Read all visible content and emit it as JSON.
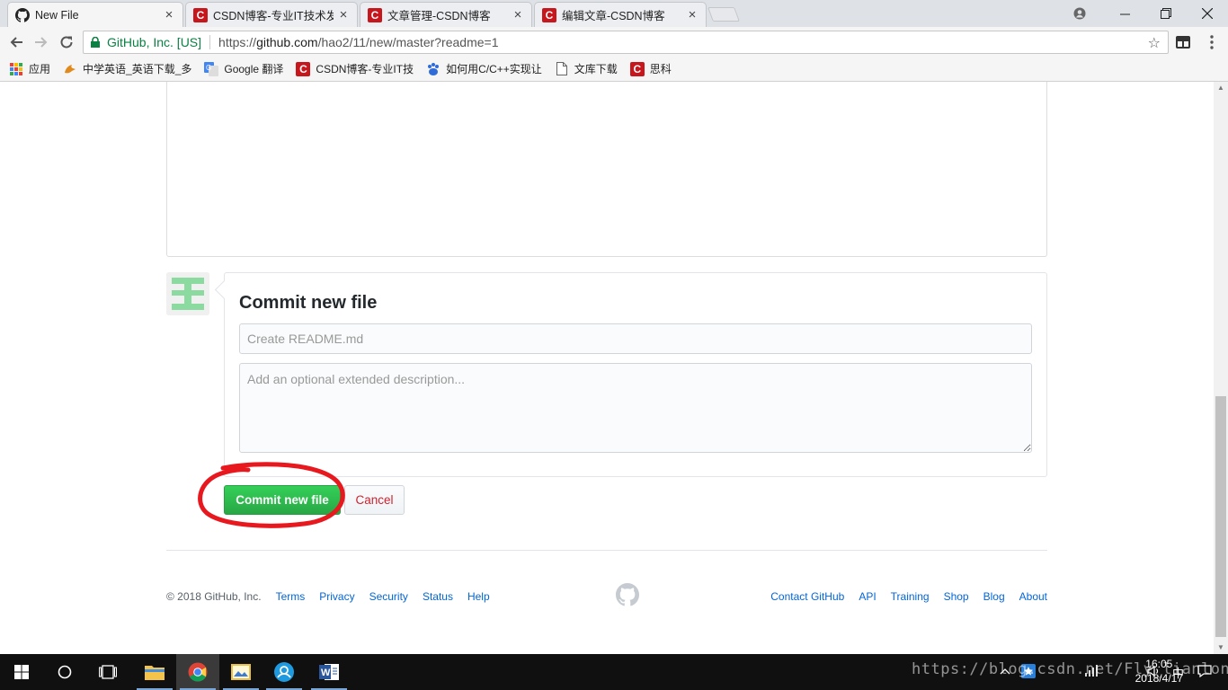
{
  "browser": {
    "tabs": [
      {
        "title": "New File",
        "favicon": "github-icon",
        "active": true
      },
      {
        "title": "CSDN博客-专业IT技术发",
        "favicon": "csdn-icon",
        "active": false
      },
      {
        "title": "文章管理-CSDN博客",
        "favicon": "csdn-icon",
        "active": false
      },
      {
        "title": "编辑文章-CSDN博客",
        "favicon": "csdn-icon",
        "active": false
      }
    ],
    "close_glyph": "×",
    "address": {
      "secure_label": "GitHub, Inc. [US]",
      "url_scheme": "https://",
      "url_host": "github.com",
      "url_path": "/hao2/11/new/master?readme=1"
    },
    "bookmarks": [
      {
        "label": "应用",
        "icon": "apps-icon"
      },
      {
        "label": "中学英语_英语下载_多",
        "icon": "folder-bird-icon"
      },
      {
        "label": "Google 翻译",
        "icon": "google-translate-icon"
      },
      {
        "label": "CSDN博客-专业IT技",
        "icon": "csdn-icon"
      },
      {
        "label": "如何用C/C++实现让",
        "icon": "baidu-paw-icon"
      },
      {
        "label": "文库下载",
        "icon": "page-icon"
      },
      {
        "label": "思科",
        "icon": "csdn-icon"
      }
    ]
  },
  "commit": {
    "title": "Commit new file",
    "summary_placeholder": "Create README.md",
    "description_placeholder": "Add an optional extended description...",
    "commit_button": "Commit new file",
    "cancel_button": "Cancel"
  },
  "footer": {
    "copyright": "© 2018 GitHub, Inc.",
    "left_links": [
      "Terms",
      "Privacy",
      "Security",
      "Status",
      "Help"
    ],
    "right_links": [
      "Contact GitHub",
      "API",
      "Training",
      "Shop",
      "Blog",
      "About"
    ]
  },
  "taskbar": {
    "time": "16:05",
    "date": "2018/4/17",
    "ime": "中",
    "watermark": "https://blog.csdn.net/Fly_lianlong"
  },
  "colors": {
    "github_green": "#28a745",
    "cancel_red": "#cb2431",
    "link_blue": "#0366d6",
    "annotation_red": "#e8181f",
    "csdn_red": "#c8161d"
  }
}
